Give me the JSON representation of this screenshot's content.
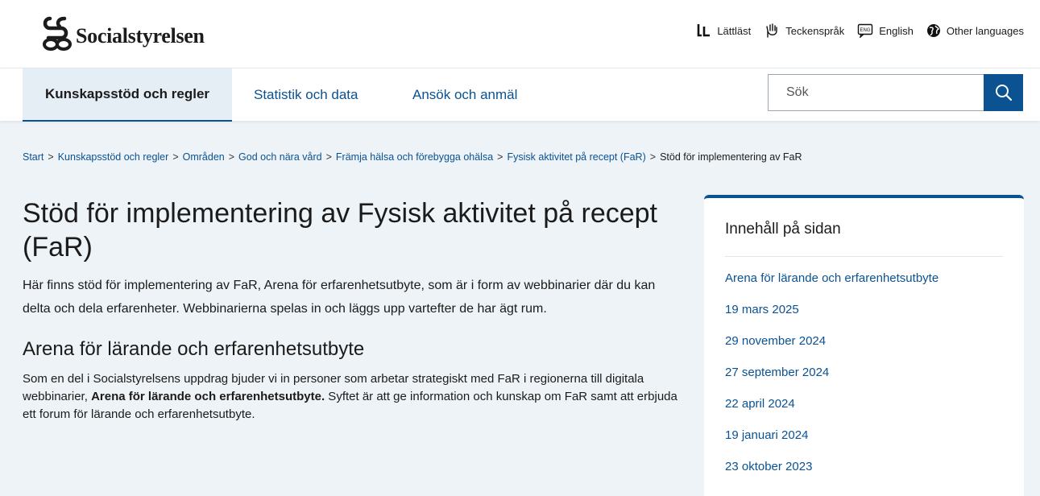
{
  "header": {
    "logo_text": "Socialstyrelsen",
    "util_links": [
      "Lättläst",
      "Teckenspråk",
      "English",
      "Other languages"
    ]
  },
  "nav": {
    "tabs": [
      "Kunskapsstöd och regler",
      "Statistik och data",
      "Ansök och anmäl"
    ],
    "active_index": 0,
    "search_placeholder": "Sök"
  },
  "breadcrumb": {
    "links": [
      "Start",
      "Kunskapsstöd och regler",
      "Områden",
      "God och nära vård",
      "Främja hälsa och förebygga ohälsa",
      "Fysisk aktivitet på recept (FaR)"
    ],
    "current": "Stöd för implementering av FaR",
    "separator": ">"
  },
  "main": {
    "title": "Stöd för implementering av Fysisk aktivitet på recept (FaR)",
    "lead": "Här finns stöd för implementering av FaR, Arena för erfarenhetsutbyte, som är i form av webbinarier där du kan delta och dela erfarenheter. Webbinarierna spelas in och läggs upp vartefter de har ägt rum.",
    "section_heading": "Arena för lärande och erfarenhetsutbyte",
    "body_before": "Som en del i Socialstyrelsens uppdrag bjuder vi in personer som arbetar strategiskt med FaR i regionerna till digitala webbinarier, ",
    "body_bold": "Arena för lärande och erfarenhetsutbyte.",
    "body_after": " Syftet är att ge information och kunskap om FaR samt att erbjuda ett forum för lärande och erfarenhetsutbyte."
  },
  "toc": {
    "title": "Innehåll på sidan",
    "items": [
      "Arena för lärande och erfarenhetsutbyte",
      "19 mars 2025",
      "29 november 2024",
      "27 september 2024",
      "22 april 2024",
      "19 januari 2024",
      "23 oktober 2023"
    ]
  },
  "colors": {
    "brand_blue": "#0a5291",
    "page_bg": "#eef3f7",
    "active_tab_bg": "#e5edf5"
  }
}
